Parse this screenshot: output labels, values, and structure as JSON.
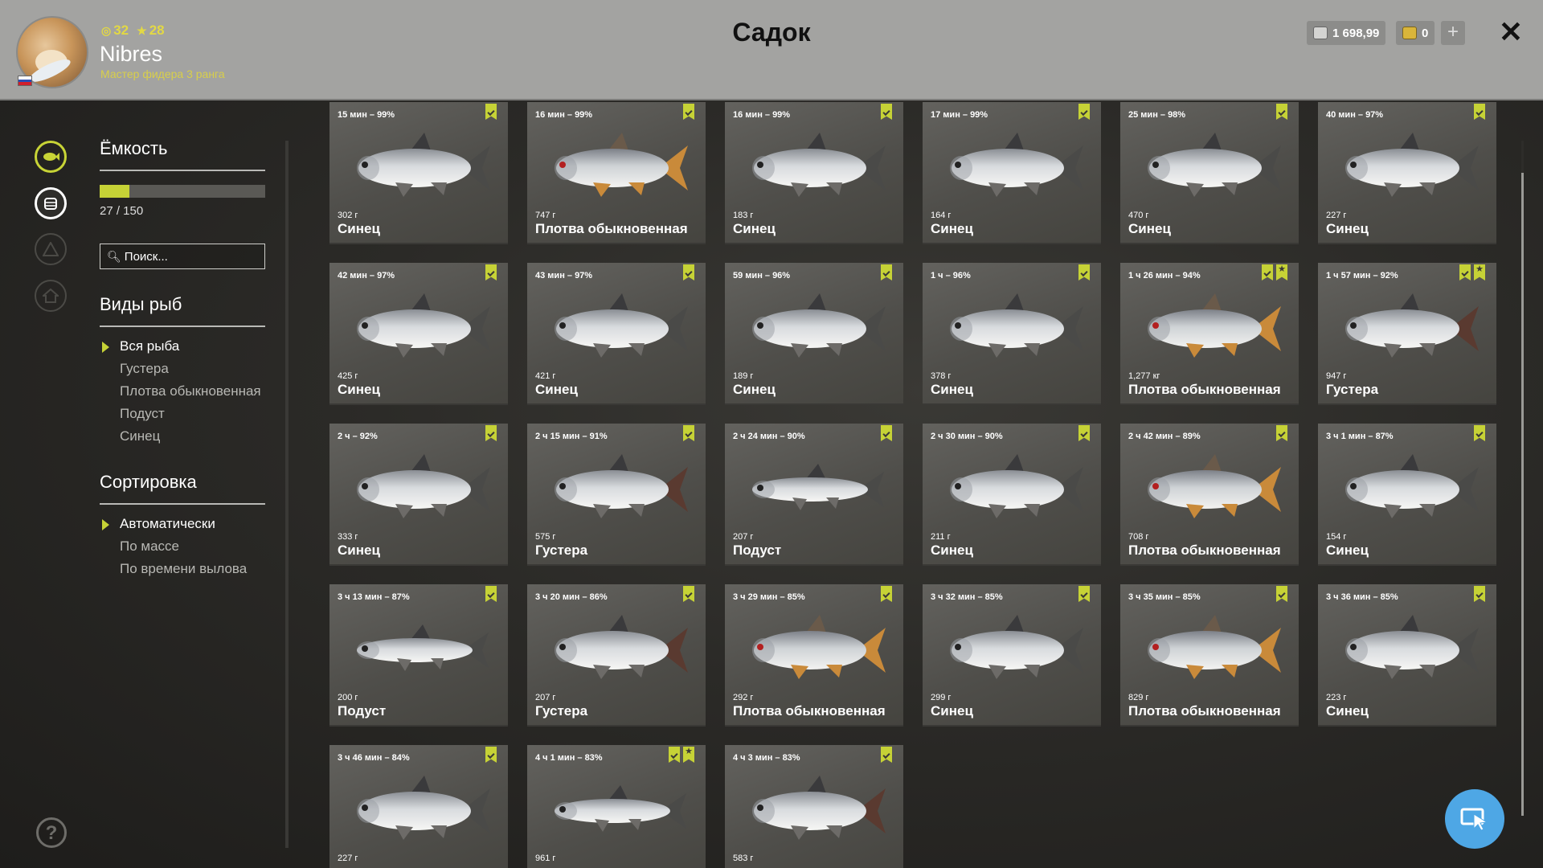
{
  "header": {
    "title": "Садок",
    "player": {
      "name": "Nibres",
      "rank": "Мастер фидера 3 ранга",
      "level": "32",
      "stars": "28",
      "flag": "russia-flag"
    },
    "currency": {
      "silver": "1 698,99",
      "gold": "0",
      "add_icon": "plus-icon",
      "close_icon": "close-icon"
    }
  },
  "sidebar": {
    "icons": [
      "fish-icon",
      "keepnet-icon",
      "camp-icon",
      "home-icon"
    ],
    "help_icon": "help-icon"
  },
  "filters": {
    "capacity_title": "Ёмкость",
    "capacity_text": "27 / 150",
    "capacity_fraction": 0.18,
    "search_placeholder": "Поиск...",
    "species_title": "Виды рыб",
    "species": [
      {
        "label": "Вся рыба",
        "active": true
      },
      {
        "label": "Густера",
        "active": false
      },
      {
        "label": "Плотва обыкновенная",
        "active": false
      },
      {
        "label": "Подуст",
        "active": false
      },
      {
        "label": "Синец",
        "active": false
      }
    ],
    "sort_title": "Сортировка",
    "sort": [
      {
        "label": "Автоматически",
        "active": true
      },
      {
        "label": "По массе",
        "active": false
      },
      {
        "label": "По времени вылова",
        "active": false
      }
    ]
  },
  "colors": {
    "accent": "#c6d236",
    "header_bg": "#a3a3a1",
    "card_bg": "#55544f",
    "help_button": "#4ea7e5"
  },
  "fish": [
    {
      "time": "15 мин – 99%",
      "weight": "302 г",
      "name": "Синец",
      "type": "bream",
      "star": false
    },
    {
      "time": "16 мин – 99%",
      "weight": "747 г",
      "name": "Плотва обыкновенная",
      "type": "roach",
      "star": false
    },
    {
      "time": "16 мин – 99%",
      "weight": "183 г",
      "name": "Синец",
      "type": "bream",
      "star": false
    },
    {
      "time": "17 мин – 99%",
      "weight": "164 г",
      "name": "Синец",
      "type": "bream",
      "star": false
    },
    {
      "time": "25 мин – 98%",
      "weight": "470 г",
      "name": "Синец",
      "type": "bream",
      "star": false
    },
    {
      "time": "40 мин – 97%",
      "weight": "227 г",
      "name": "Синец",
      "type": "bream",
      "star": false
    },
    {
      "time": "42 мин – 97%",
      "weight": "425 г",
      "name": "Синец",
      "type": "bream",
      "star": false
    },
    {
      "time": "43 мин – 97%",
      "weight": "421 г",
      "name": "Синец",
      "type": "bream",
      "star": false
    },
    {
      "time": "59 мин – 96%",
      "weight": "189 г",
      "name": "Синец",
      "type": "bream",
      "star": false
    },
    {
      "time": "1 ч – 96%",
      "weight": "378 г",
      "name": "Синец",
      "type": "bream",
      "star": false
    },
    {
      "time": "1 ч 26 мин – 94%",
      "weight": "1,277 кг",
      "name": "Плотва обыкновенная",
      "type": "roach",
      "star": true
    },
    {
      "time": "1 ч 57 мин – 92%",
      "weight": "947 г",
      "name": "Густера",
      "type": "silverbream",
      "star": true
    },
    {
      "time": "2 ч – 92%",
      "weight": "333 г",
      "name": "Синец",
      "type": "bream",
      "star": false
    },
    {
      "time": "2 ч 15 мин – 91%",
      "weight": "575 г",
      "name": "Густера",
      "type": "silverbream",
      "star": false
    },
    {
      "time": "2 ч 24 мин – 90%",
      "weight": "207 г",
      "name": "Подуст",
      "type": "nase",
      "star": false
    },
    {
      "time": "2 ч 30 мин – 90%",
      "weight": "211 г",
      "name": "Синец",
      "type": "bream",
      "star": false
    },
    {
      "time": "2 ч 42 мин – 89%",
      "weight": "708 г",
      "name": "Плотва обыкновенная",
      "type": "roach",
      "star": false
    },
    {
      "time": "3 ч 1 мин – 87%",
      "weight": "154 г",
      "name": "Синец",
      "type": "bream",
      "star": false
    },
    {
      "time": "3 ч 13 мин – 87%",
      "weight": "200 г",
      "name": "Подуст",
      "type": "nase",
      "star": false
    },
    {
      "time": "3 ч 20 мин – 86%",
      "weight": "207 г",
      "name": "Густера",
      "type": "silverbream",
      "star": false
    },
    {
      "time": "3 ч 29 мин – 85%",
      "weight": "292 г",
      "name": "Плотва обыкновенная",
      "type": "roach",
      "star": false
    },
    {
      "time": "3 ч 32 мин – 85%",
      "weight": "299 г",
      "name": "Синец",
      "type": "bream",
      "star": false
    },
    {
      "time": "3 ч 35 мин – 85%",
      "weight": "829 г",
      "name": "Плотва обыкновенная",
      "type": "roach",
      "star": false
    },
    {
      "time": "3 ч 36 мин – 85%",
      "weight": "223 г",
      "name": "Синец",
      "type": "bream",
      "star": false
    },
    {
      "time": "3 ч 46 мин – 84%",
      "weight": "227 г",
      "name": "",
      "type": "bream",
      "star": false
    },
    {
      "time": "4 ч 1 мин – 83%",
      "weight": "961 г",
      "name": "",
      "type": "nase",
      "star": true
    },
    {
      "time": "4 ч 3 мин – 83%",
      "weight": "583 г",
      "name": "",
      "type": "silverbream",
      "star": false
    }
  ]
}
